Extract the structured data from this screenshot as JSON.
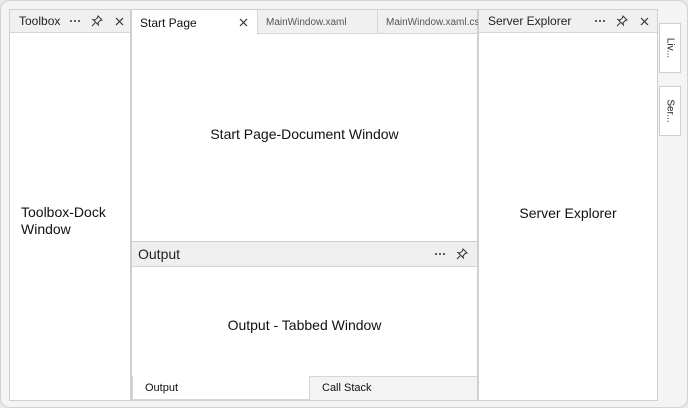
{
  "toolbox": {
    "title": "Toolbox",
    "body_label": [
      "Toolbox-Dock",
      "Window"
    ]
  },
  "document": {
    "tabs": [
      {
        "label": "Start Page",
        "active": true
      },
      {
        "label": "MainWindow.xaml",
        "active": false
      },
      {
        "label": "MainWindow.xaml.cs",
        "active": false
      }
    ],
    "body_label": "Start Page-Document Window"
  },
  "output": {
    "title": "Output",
    "body_label": "Output - Tabbed Window",
    "tabs": [
      {
        "label": "Output",
        "active": true
      },
      {
        "label": "Call Stack",
        "active": false
      }
    ]
  },
  "server_explorer": {
    "title": "Server Explorer",
    "body_label": "Server Explorer"
  },
  "side_tabs": [
    "Liv...",
    "Ser..."
  ],
  "icons": {
    "more": "ellipsis-icon",
    "pin": "pin-icon",
    "close": "close-icon"
  }
}
